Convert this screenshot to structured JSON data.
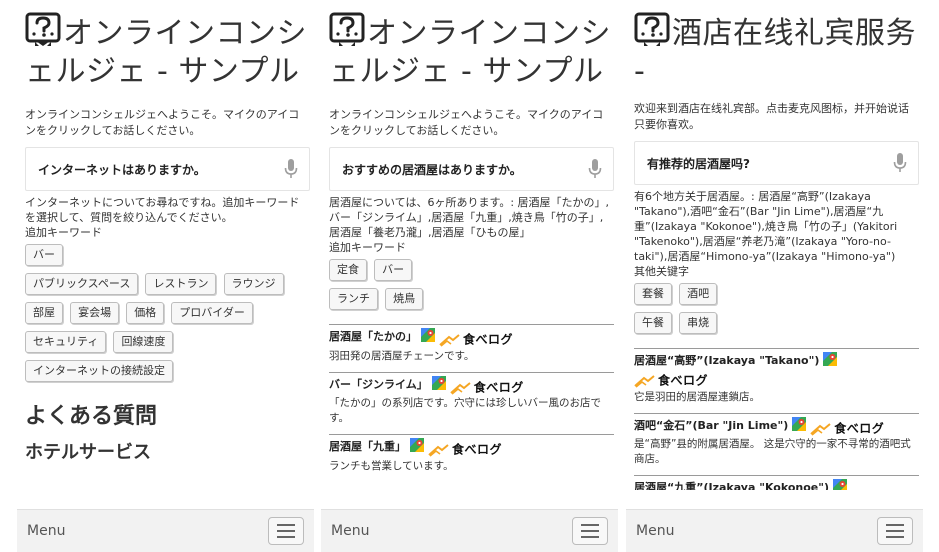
{
  "panels": [
    {
      "title": "オンラインコンシェルジェ - サンプル",
      "intro": "オンラインコンシェルジェへようこそ。マイクのアイコンをクリックしてお話しください。",
      "query": "インターネットはありますか。",
      "answer": "インターネットについてお尋ねですね。追加キーワードを選択して、質問を絞り込んでください。",
      "keywords_label": "追加キーワード",
      "chip_rows": [
        [
          "バー"
        ],
        [
          "パブリックスペース",
          "レストラン",
          "ラウンジ"
        ],
        [
          "部屋",
          "宴会場",
          "価格",
          "プロバイダー"
        ],
        [
          "セキュリティ",
          "回線速度"
        ],
        [
          "インターネットの接続設定"
        ]
      ],
      "faq_title": "よくある質問",
      "faq_sub": "ホテルサービス",
      "menu_label": "Menu"
    },
    {
      "title": "オンラインコンシェルジェ - サンプル",
      "intro": "オンラインコンシェルジェへようこそ。マイクのアイコンをクリックしてお話しください。",
      "query": "おすすめの居酒屋はありますか。",
      "answer": "居酒屋については、6ヶ所あります。: 居酒屋「たかの」,バー「ジンライム」,居酒屋「九重」,焼き鳥「竹の子」,居酒屋「養老乃瀧」,居酒屋「ひもの屋」",
      "keywords_label": "追加キーワード",
      "chip_rows": [
        [
          "定食",
          "バー"
        ],
        [
          "ランチ",
          "焼鳥"
        ]
      ],
      "tabelog_label": "食べログ",
      "shops": [
        {
          "name": "居酒屋「たかの」",
          "desc": "羽田発の居酒屋チェーンです。"
        },
        {
          "name": "バー「ジンライム」",
          "desc": "「たかの」の系列店です。穴守には珍しいバー風のお店です。"
        },
        {
          "name": "居酒屋「九重」",
          "desc": "ランチも営業しています。"
        }
      ],
      "menu_label": "Menu"
    },
    {
      "title": "酒店在线礼宾服务 -",
      "intro": "欢迎来到酒店在线礼宾部。点击麦克风图标，并开始说话只要你喜欢。",
      "query": "有推荐的居酒屋吗?",
      "answer": "有6个地方关于居酒屋。: 居酒屋“高野”(Izakaya \"Takano\"),酒吧“金石”(Bar \"Jin Lime\"),居酒屋“九重”(Izakaya \"Kokonoe\"),焼き鳥「竹の子」(Yakitori \"Takenoko\"),居酒屋“养老乃滝”(Izakaya \"Yoro-no-taki\"),居酒屋“Himono-ya”(Izakaya \"Himono-ya\")",
      "keywords_label": "其他关键字",
      "chip_rows": [
        [
          "套餐",
          "酒吧"
        ],
        [
          "午餐",
          "串烧"
        ]
      ],
      "tabelog_label": "食べログ",
      "shops": [
        {
          "name": "居酒屋“高野”(Izakaya \"Takano\")",
          "desc": "它是羽田的居酒屋連鎖店。",
          "tabelog_newline": true
        },
        {
          "name": "酒吧“金石”(Bar \"Jin Lime\")",
          "desc": "是“高野”县的附属居酒屋。 这是穴守的一家不寻常的酒吧式商店。"
        },
        {
          "name": "居酒屋“九重”(Izakaya \"Kokonoe\")",
          "desc": ""
        }
      ],
      "menu_label": "Menu"
    }
  ],
  "colors": {
    "logo": "#222222",
    "mic": "#9e9e9e",
    "map_green": "#34a853",
    "map_red": "#ea4335",
    "map_blue": "#4285f4",
    "map_yellow": "#fbbc05",
    "tabelog_orange": "#f5a623",
    "menu_bar": "#f2f2f2"
  },
  "icons": {
    "logo": "concierge-logo-icon",
    "mic": "microphone-icon",
    "map": "google-maps-icon",
    "tabelog": "tabelog-logo-icon",
    "menu": "hamburger-menu-icon"
  }
}
